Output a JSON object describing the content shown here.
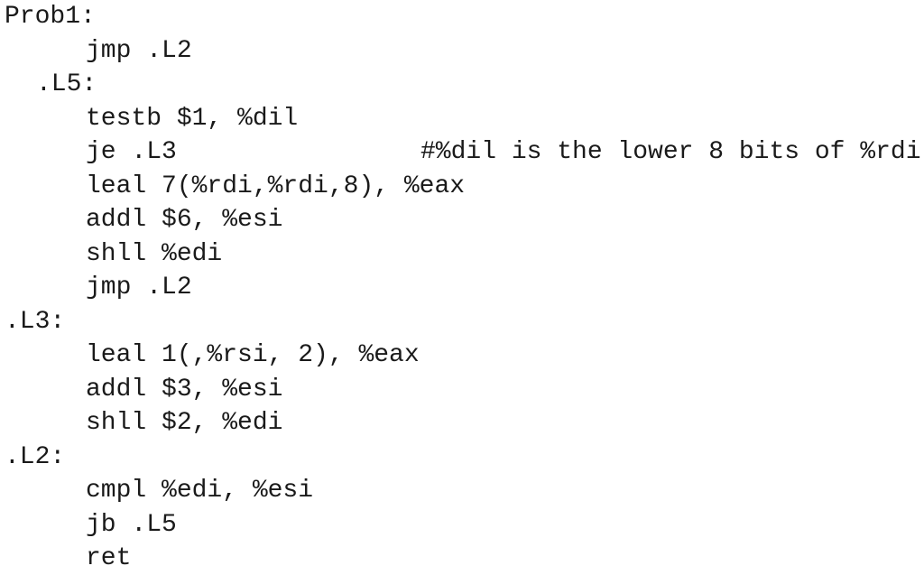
{
  "document": {
    "language": "x86-64 assembly (AT&T syntax)",
    "lines": [
      {
        "kind": "label",
        "text": "Prob1:"
      },
      {
        "kind": "instruction",
        "text": "jmp .L2"
      },
      {
        "kind": "label",
        "text": ".L5:"
      },
      {
        "kind": "instruction",
        "text": "testb $1, %dil",
        "comment": "#%dil is the lower 8 bits of %rdi"
      },
      {
        "kind": "instruction",
        "text": "je .L3"
      },
      {
        "kind": "instruction",
        "text": "leal 7(%rdi,%rdi,8), %eax"
      },
      {
        "kind": "instruction",
        "text": "addl $6, %esi"
      },
      {
        "kind": "instruction",
        "text": "shll %edi"
      },
      {
        "kind": "instruction",
        "text": "jmp .L2"
      },
      {
        "kind": "label",
        "text": ".L3:"
      },
      {
        "kind": "instruction",
        "text": "leal 1(,%rsi, 2), %eax"
      },
      {
        "kind": "instruction",
        "text": "addl $3, %esi"
      },
      {
        "kind": "instruction",
        "text": "shll $2, %edi"
      },
      {
        "kind": "label",
        "text": ".L2:"
      },
      {
        "kind": "instruction",
        "text": "cmpl %edi, %esi"
      },
      {
        "kind": "instruction",
        "text": "jb .L5"
      },
      {
        "kind": "instruction",
        "text": "ret"
      }
    ]
  }
}
